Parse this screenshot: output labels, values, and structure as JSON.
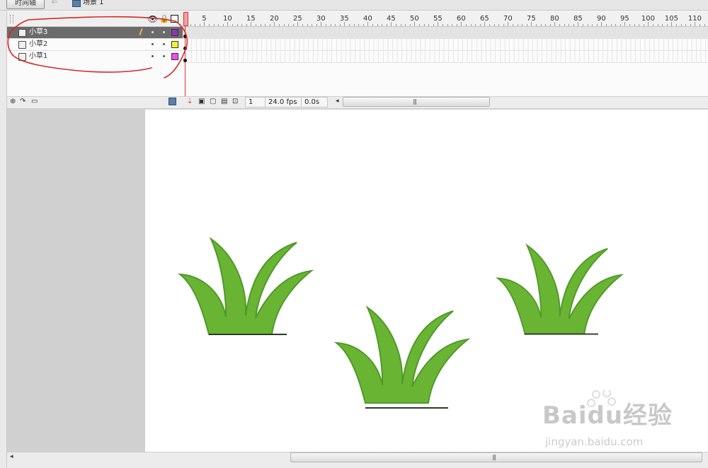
{
  "topbar": {
    "timeline_button": "时间轴",
    "scene_label": "场景 1"
  },
  "layers": [
    {
      "name": "小草3",
      "color": "#9b2fb3",
      "selected": true
    },
    {
      "name": "小草2",
      "color": "#f2f23a",
      "selected": false
    },
    {
      "name": "小草1",
      "color": "#f04ef0",
      "selected": false
    }
  ],
  "ruler": {
    "labels": [
      "5",
      "10",
      "15",
      "20",
      "25",
      "30",
      "35",
      "40",
      "45",
      "50",
      "55",
      "60",
      "65",
      "70",
      "75",
      "80",
      "85",
      "90",
      "95",
      "100",
      "105",
      "110"
    ]
  },
  "status": {
    "current_frame": "1",
    "fps": "24.0 fps",
    "time": "0.0s"
  },
  "grass": {
    "fill": "#6ab434",
    "edge": "#4b8f24",
    "base": "#2b3a22"
  },
  "annotation_color": "#d42a2a",
  "watermark": {
    "line1": "Baidu经验",
    "line2": "jingyan.baidu.com"
  }
}
